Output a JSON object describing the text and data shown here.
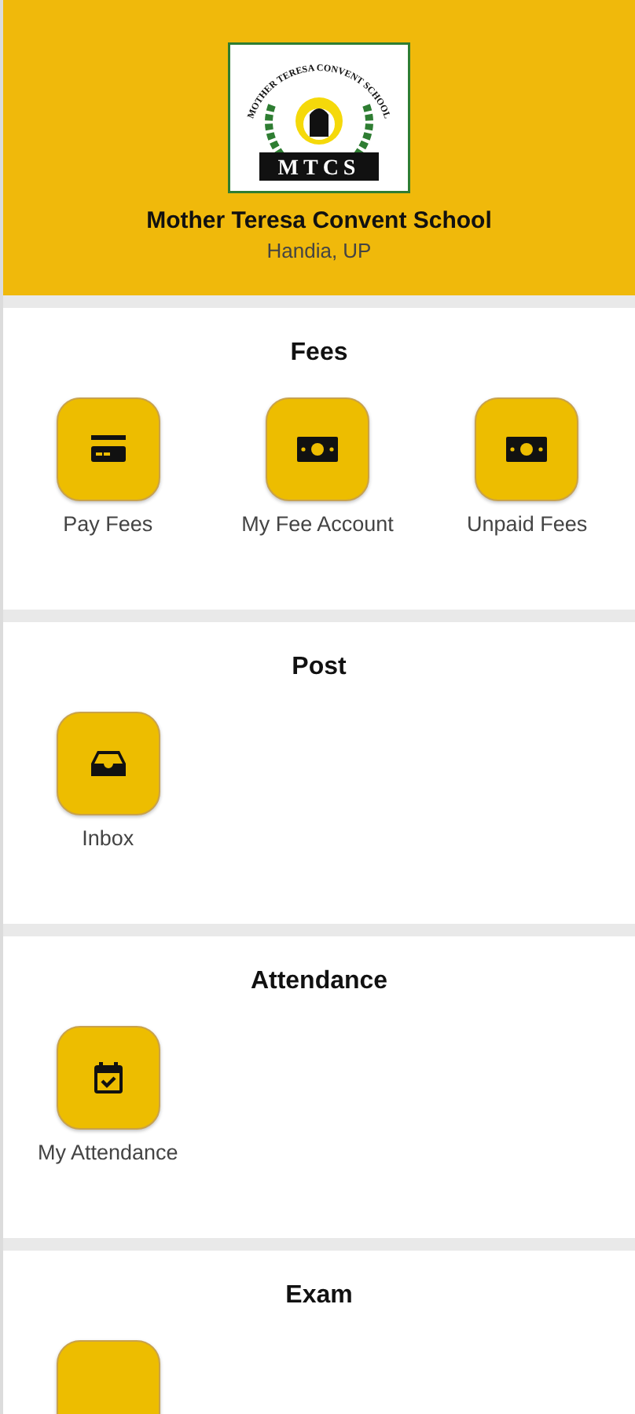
{
  "header": {
    "logo": {
      "arc_text": "MOTHER TERESA CONVENT SCHOOL",
      "initials": "MTCS"
    },
    "title": "Mother Teresa Convent School",
    "subtitle": "Handia, UP"
  },
  "sections": [
    {
      "title": "Fees",
      "items": [
        {
          "kind": "card",
          "label": "Pay Fees"
        },
        {
          "kind": "cash",
          "label": "My Fee Account"
        },
        {
          "kind": "cash",
          "label": "Unpaid Fees"
        }
      ]
    },
    {
      "title": "Post",
      "items": [
        {
          "kind": "inbox",
          "label": "Inbox"
        }
      ]
    },
    {
      "title": "Attendance",
      "items": [
        {
          "kind": "calendar",
          "label": "My Attendance"
        }
      ]
    },
    {
      "title": "Exam",
      "items": [
        {
          "kind": "blank"
        }
      ]
    }
  ]
}
